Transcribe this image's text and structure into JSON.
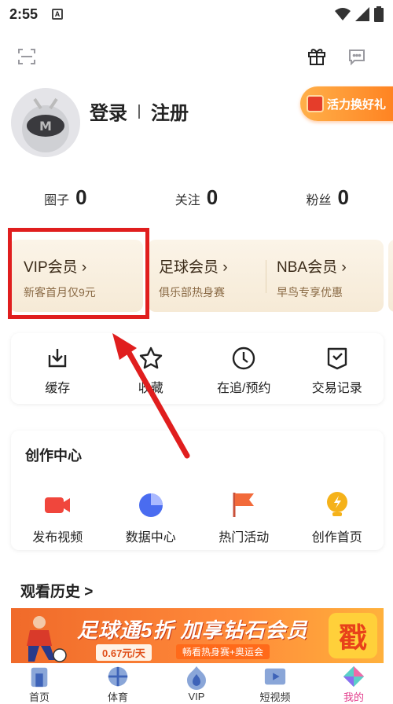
{
  "status_bar": {
    "time": "2:55",
    "notif_letter": "A"
  },
  "profile": {
    "login": "登录",
    "register": "注册",
    "promo": "活力换好礼"
  },
  "stats": [
    {
      "label": "圈子",
      "value": "0"
    },
    {
      "label": "关注",
      "value": "0"
    },
    {
      "label": "粉丝",
      "value": "0"
    }
  ],
  "members": {
    "vip": {
      "title": "VIP会员 ›",
      "sub": "新客首月仅9元"
    },
    "football": {
      "title": "足球会员 ›",
      "sub": "俱乐部热身赛"
    },
    "nba": {
      "title": "NBA会员 ›",
      "sub": "早鸟专享优惠"
    }
  },
  "quick": [
    {
      "label": "缓存",
      "icon": "download-icon"
    },
    {
      "label": "收藏",
      "icon": "star-icon"
    },
    {
      "label": "在追/预约",
      "icon": "clock-icon"
    },
    {
      "label": "交易记录",
      "icon": "receipt-check-icon"
    }
  ],
  "creator": {
    "title": "创作中心",
    "items": [
      {
        "label": "发布视频",
        "icon": "video-camera-icon",
        "color": "#f0463c"
      },
      {
        "label": "数据中心",
        "icon": "pie-chart-icon",
        "color": "#4a6cf0"
      },
      {
        "label": "热门活动",
        "icon": "flag-icon",
        "color": "#f26a3a"
      },
      {
        "label": "创作首页",
        "icon": "lightning-bulb-icon",
        "color": "#f5b21a"
      }
    ]
  },
  "history": {
    "title": "观看历史 >"
  },
  "banner": {
    "headline": "足球通5折 加享钻石会员",
    "price": "0.67元/天",
    "sub": "畅看热身赛+奥运会",
    "stamp": "戳"
  },
  "tabs": [
    {
      "label": "首页",
      "icon": "home-icon"
    },
    {
      "label": "体育",
      "icon": "sports-icon"
    },
    {
      "label": "VIP",
      "icon": "vip-flame-icon"
    },
    {
      "label": "短视频",
      "icon": "short-video-icon"
    },
    {
      "label": "我的",
      "icon": "profile-diamond-icon",
      "active": true
    }
  ],
  "colors": {
    "highlight": "#e01e1e",
    "accent_pink": "#e23a8a",
    "gold_card": "#f6ead6"
  }
}
